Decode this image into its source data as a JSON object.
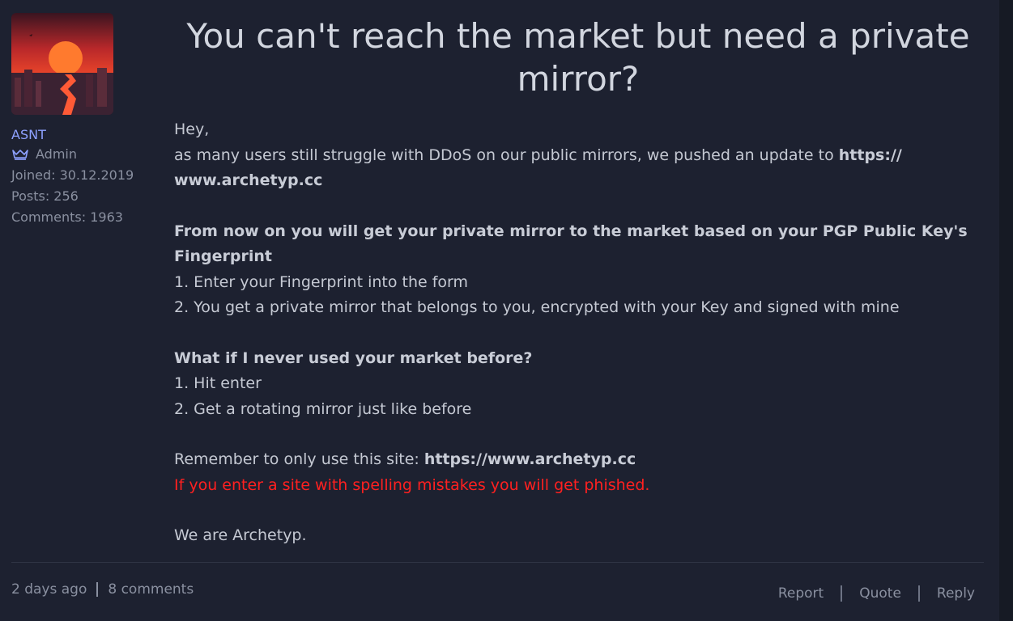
{
  "post": {
    "title": "You can't reach the market but need a private mirror?",
    "author": {
      "name": "ASNT",
      "role": "Admin",
      "role_icon": "crown-icon",
      "joined": "Joined: 30.12.2019",
      "posts": "Posts: 256",
      "comments": "Comments: 1963"
    },
    "body": {
      "greeting": "Hey,",
      "intro_text": "as many users still struggle with DDoS on our public mirrors, we pushed an update to ",
      "intro_link": "https:// www.archetyp.cc",
      "section1_heading": "From now on you will get your private mirror to the market based on your PGP Public Key's Fingerprint",
      "section1_step1": "1. Enter your Fingerprint into the form",
      "section1_step2": "2. You get a private mirror that belongs to you, encrypted with your Key and signed with mine",
      "section2_heading": "What if I never used your market before?",
      "section2_step1": "1. Hit enter",
      "section2_step2": "2. Get a rotating mirror just like before",
      "remember_text": "Remember to only use this site: ",
      "remember_link": "https://www.archetyp.cc",
      "warning": "If you enter a site with spelling mistakes you will get phished.",
      "signoff": "We are Archetyp."
    },
    "footer": {
      "age": "2 days ago",
      "comments": "8 comments",
      "report": "Report",
      "quote": "Quote",
      "reply": "Reply"
    }
  },
  "colors": {
    "background": "#1d2130",
    "author_link": "#8ea1ff",
    "muted": "#8a90a0",
    "warning": "#ff2020"
  }
}
